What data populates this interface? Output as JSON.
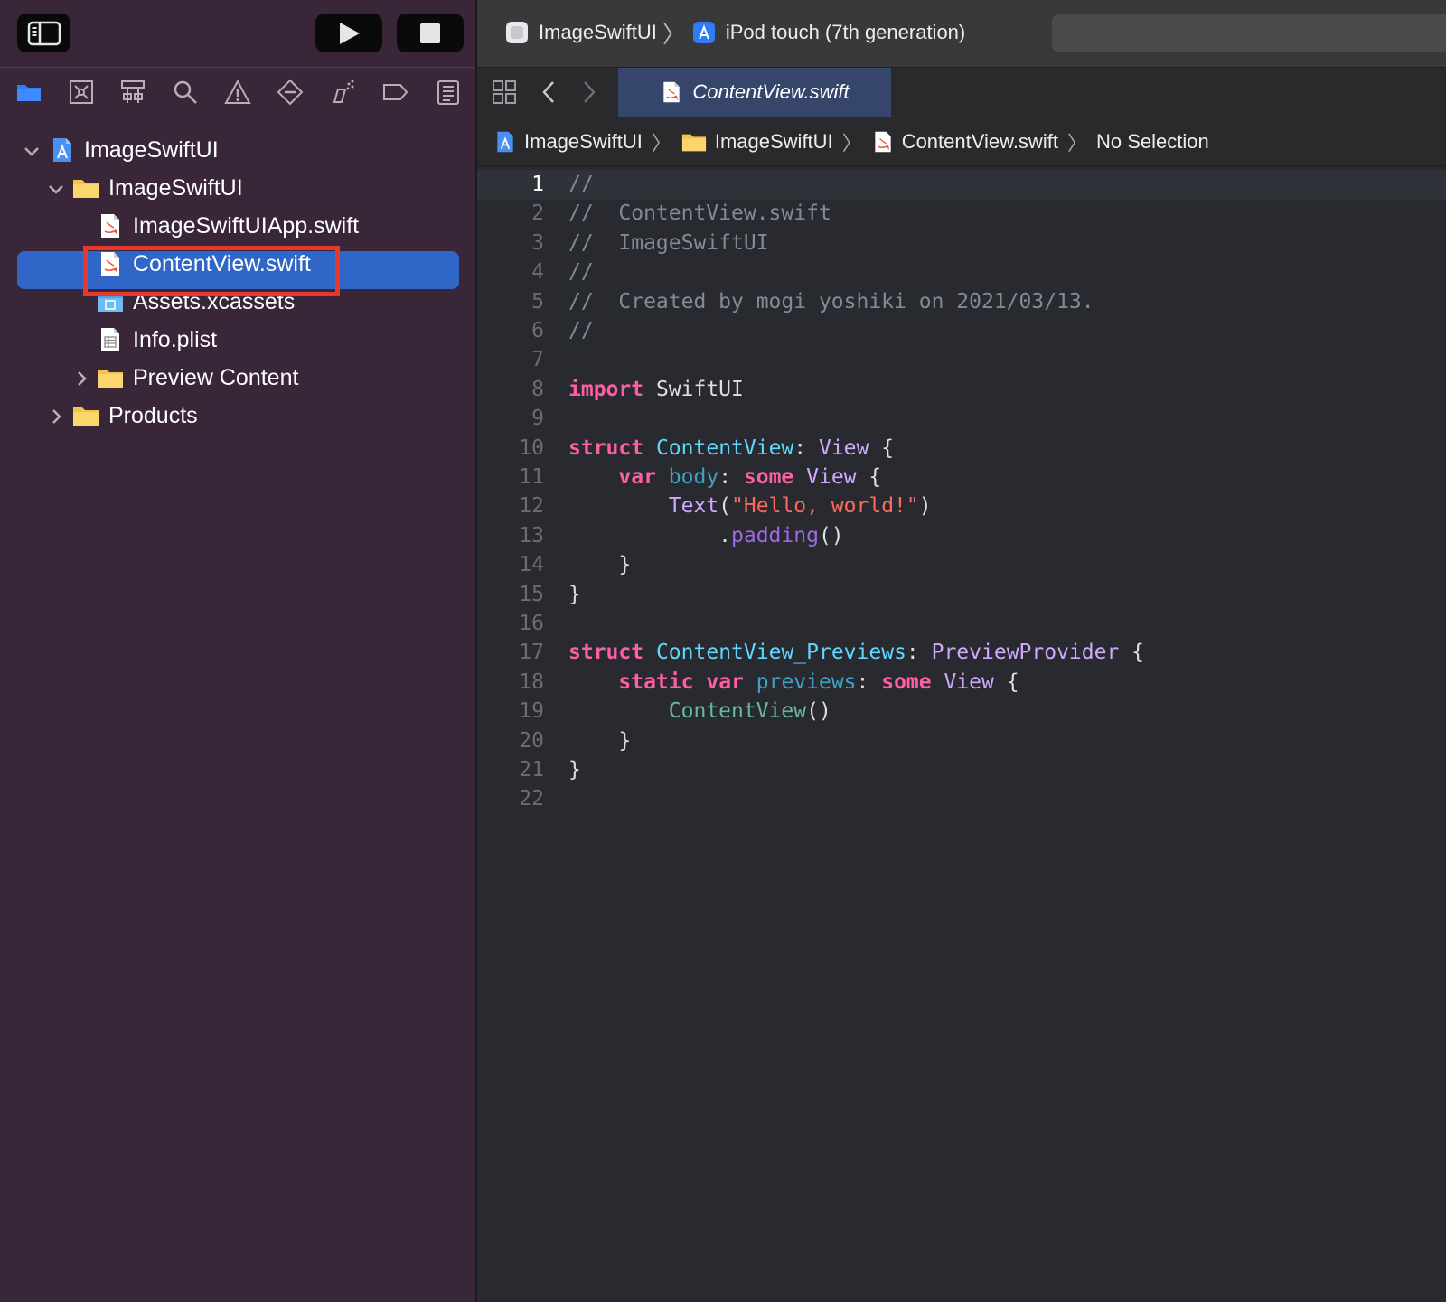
{
  "toolbar": {
    "scheme_project": "ImageSwiftUI",
    "scheme_device": "iPod touch (7th generation)"
  },
  "navigator": {
    "tree": [
      {
        "label": "ImageSwiftUI",
        "kind": "project",
        "disclosure": "expanded"
      },
      {
        "label": "ImageSwiftUI",
        "kind": "folder",
        "disclosure": "expanded"
      },
      {
        "label": "ImageSwiftUIApp.swift",
        "kind": "swift"
      },
      {
        "label": "ContentView.swift",
        "kind": "swift",
        "selected": true
      },
      {
        "label": "Assets.xcassets",
        "kind": "assets"
      },
      {
        "label": "Info.plist",
        "kind": "plist"
      },
      {
        "label": "Preview Content",
        "kind": "folder",
        "disclosure": "collapsed"
      },
      {
        "label": "Products",
        "kind": "folder",
        "disclosure": "collapsed"
      }
    ]
  },
  "editor": {
    "tab_label": "ContentView.swift",
    "jumpbar": {
      "project": "ImageSwiftUI",
      "group": "ImageSwiftUI",
      "file": "ContentView.swift",
      "symbol": "No Selection"
    },
    "current_line": 1,
    "line_numbers": [
      "1",
      "2",
      "3",
      "4",
      "5",
      "6",
      "7",
      "8",
      "9",
      "10",
      "11",
      "12",
      "13",
      "14",
      "15",
      "16",
      "17",
      "18",
      "19",
      "20",
      "21",
      "22"
    ],
    "code_lines": [
      {
        "parts": [
          {
            "t": "//",
            "c": "com"
          }
        ]
      },
      {
        "parts": [
          {
            "t": "//  ContentView.swift",
            "c": "com"
          }
        ]
      },
      {
        "parts": [
          {
            "t": "//  ImageSwiftUI",
            "c": "com"
          }
        ]
      },
      {
        "parts": [
          {
            "t": "//",
            "c": "com"
          }
        ]
      },
      {
        "parts": [
          {
            "t": "//  Created by mogi yoshiki on 2021/03/13.",
            "c": "com"
          }
        ]
      },
      {
        "parts": [
          {
            "t": "//",
            "c": "com"
          }
        ]
      },
      {
        "parts": []
      },
      {
        "parts": [
          {
            "t": "import",
            "c": "kw"
          },
          {
            "t": " SwiftUI",
            "c": "other"
          }
        ]
      },
      {
        "parts": []
      },
      {
        "parts": [
          {
            "t": "struct",
            "c": "kw"
          },
          {
            "t": " ",
            "c": "other"
          },
          {
            "t": "ContentView",
            "c": "decl"
          },
          {
            "t": ": ",
            "c": "other"
          },
          {
            "t": "View",
            "c": "type"
          },
          {
            "t": " {",
            "c": "other"
          }
        ]
      },
      {
        "parts": [
          {
            "t": "    ",
            "c": "other"
          },
          {
            "t": "var",
            "c": "kw"
          },
          {
            "t": " ",
            "c": "other"
          },
          {
            "t": "body",
            "c": "decl2"
          },
          {
            "t": ": ",
            "c": "other"
          },
          {
            "t": "some",
            "c": "kw"
          },
          {
            "t": " ",
            "c": "other"
          },
          {
            "t": "View",
            "c": "type"
          },
          {
            "t": " {",
            "c": "other"
          }
        ]
      },
      {
        "parts": [
          {
            "t": "        ",
            "c": "other"
          },
          {
            "t": "Text",
            "c": "type"
          },
          {
            "t": "(",
            "c": "other"
          },
          {
            "t": "\"Hello, world!\"",
            "c": "str"
          },
          {
            "t": ")",
            "c": "other"
          }
        ]
      },
      {
        "parts": [
          {
            "t": "            .",
            "c": "other"
          },
          {
            "t": "padding",
            "c": "otype"
          },
          {
            "t": "()",
            "c": "other"
          }
        ]
      },
      {
        "parts": [
          {
            "t": "    }",
            "c": "other"
          }
        ]
      },
      {
        "parts": [
          {
            "t": "}",
            "c": "other"
          }
        ]
      },
      {
        "parts": []
      },
      {
        "parts": [
          {
            "t": "struct",
            "c": "kw"
          },
          {
            "t": " ",
            "c": "other"
          },
          {
            "t": "ContentView_Previews",
            "c": "decl"
          },
          {
            "t": ": ",
            "c": "other"
          },
          {
            "t": "PreviewProvider",
            "c": "type"
          },
          {
            "t": " {",
            "c": "other"
          }
        ]
      },
      {
        "parts": [
          {
            "t": "    ",
            "c": "other"
          },
          {
            "t": "static",
            "c": "kw"
          },
          {
            "t": " ",
            "c": "other"
          },
          {
            "t": "var",
            "c": "kw"
          },
          {
            "t": " ",
            "c": "other"
          },
          {
            "t": "previews",
            "c": "decl2"
          },
          {
            "t": ": ",
            "c": "other"
          },
          {
            "t": "some",
            "c": "kw"
          },
          {
            "t": " ",
            "c": "other"
          },
          {
            "t": "View",
            "c": "type"
          },
          {
            "t": " {",
            "c": "other"
          }
        ]
      },
      {
        "parts": [
          {
            "t": "        ",
            "c": "other"
          },
          {
            "t": "ContentView",
            "c": "func"
          },
          {
            "t": "()",
            "c": "other"
          }
        ]
      },
      {
        "parts": [
          {
            "t": "    }",
            "c": "other"
          }
        ]
      },
      {
        "parts": [
          {
            "t": "}",
            "c": "other"
          }
        ]
      },
      {
        "parts": []
      }
    ]
  },
  "colors": {
    "sidebar_bg": "#392639",
    "editor_bg": "#292a30",
    "selection": "#2f66c8",
    "annotation_box": "#e8382b",
    "keyword": "#fc5fa3",
    "comment": "#7f8c98",
    "string": "#fc6a5d"
  },
  "icons": {
    "sidebar_toggle": "sidebar-icon",
    "run": "play-icon",
    "stop": "stop-icon",
    "navigators": [
      "folder-icon",
      "source-control-icon",
      "symbol-icon",
      "search-icon",
      "warning-icon",
      "test-icon",
      "debug-icon",
      "breakpoint-icon",
      "report-icon"
    ]
  }
}
